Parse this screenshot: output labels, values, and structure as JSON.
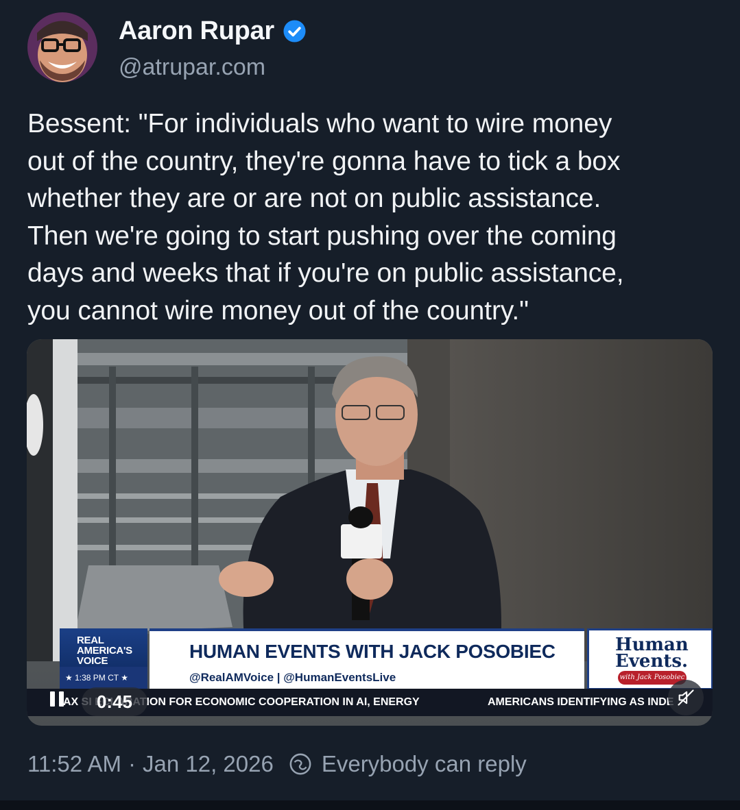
{
  "author": {
    "name": "Aaron Rupar",
    "handle": "@atrupar.com",
    "verified": true
  },
  "post": {
    "text": "Bessent: \"For individuals who want to wire money\nout of the country, they're gonna have to tick a box\nwhether they are or are not on public assistance.\nThen we're going to start pushing over the coming\ndays and weeks that if you're on public assistance,\nyou cannot wire money out of the country.\""
  },
  "video": {
    "network_logo_line1": "REAL",
    "network_logo_line2": "AMERICA'S",
    "network_logo_line3": "VOICE",
    "show_title": "HUMAN EVENTS WITH JACK POSOBIEC",
    "social_handles": "@RealAMVoice | @HumanEventsLive",
    "broadcast_time": "★ 1:38 PM CT ★",
    "show_logo_line1": "Human",
    "show_logo_line2": "Events.",
    "show_logo_tag": "with Jack Posobiec",
    "ticker_left": "AX SI          ECLARATION FOR ECONOMIC COOPERATION IN AI, ENERGY",
    "ticker_right": "AMERICANS IDENTIFYING AS INDE",
    "elapsed": "0:45",
    "state": "playing",
    "muted": true
  },
  "meta": {
    "time": "11:52 AM",
    "separator": "·",
    "date": "Jan 12, 2026",
    "reply_setting": "Everybody can reply"
  },
  "colors": {
    "background": "#161e29",
    "text": "#f1f3f5",
    "muted": "#97a3b2",
    "verified": "#1d8cf8"
  }
}
